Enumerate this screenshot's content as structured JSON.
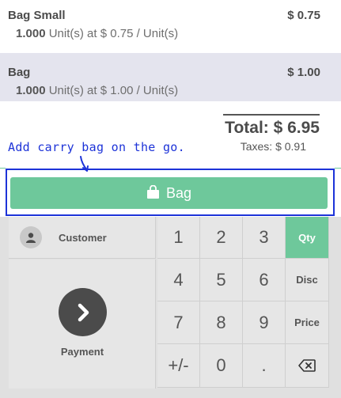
{
  "orderlines": [
    {
      "name": "Bag Small",
      "price": "$ 0.75",
      "qty": "1.000",
      "detail": "Unit(s) at $ 0.75 / Unit(s)",
      "selected": false
    },
    {
      "name": "Bag",
      "price": "$ 1.00",
      "qty": "1.000",
      "detail": "Unit(s) at $ 1.00 / Unit(s)",
      "selected": true
    }
  ],
  "summary": {
    "total": "Total: $ 6.95",
    "taxes": "Taxes: $ 0.91"
  },
  "annotation": {
    "note": "Add carry bag on the go."
  },
  "bag_button": {
    "label": "Bag",
    "icon": "shopping-bag-icon"
  },
  "actions": {
    "customer_label": "Customer",
    "customer_icon": "user-icon",
    "payment_label": "Payment",
    "payment_icon": "chevron-right-icon"
  },
  "numpad": {
    "keys": [
      "1",
      "2",
      "3",
      "Qty",
      "4",
      "5",
      "6",
      "Disc",
      "7",
      "8",
      "9",
      "Price",
      "+/-",
      "0",
      ".",
      "⌫"
    ],
    "active_mode": "Qty"
  },
  "colors": {
    "accent": "#6ec89b",
    "annotation": "#1d33d8",
    "selected_row": "#e4e4ee"
  }
}
